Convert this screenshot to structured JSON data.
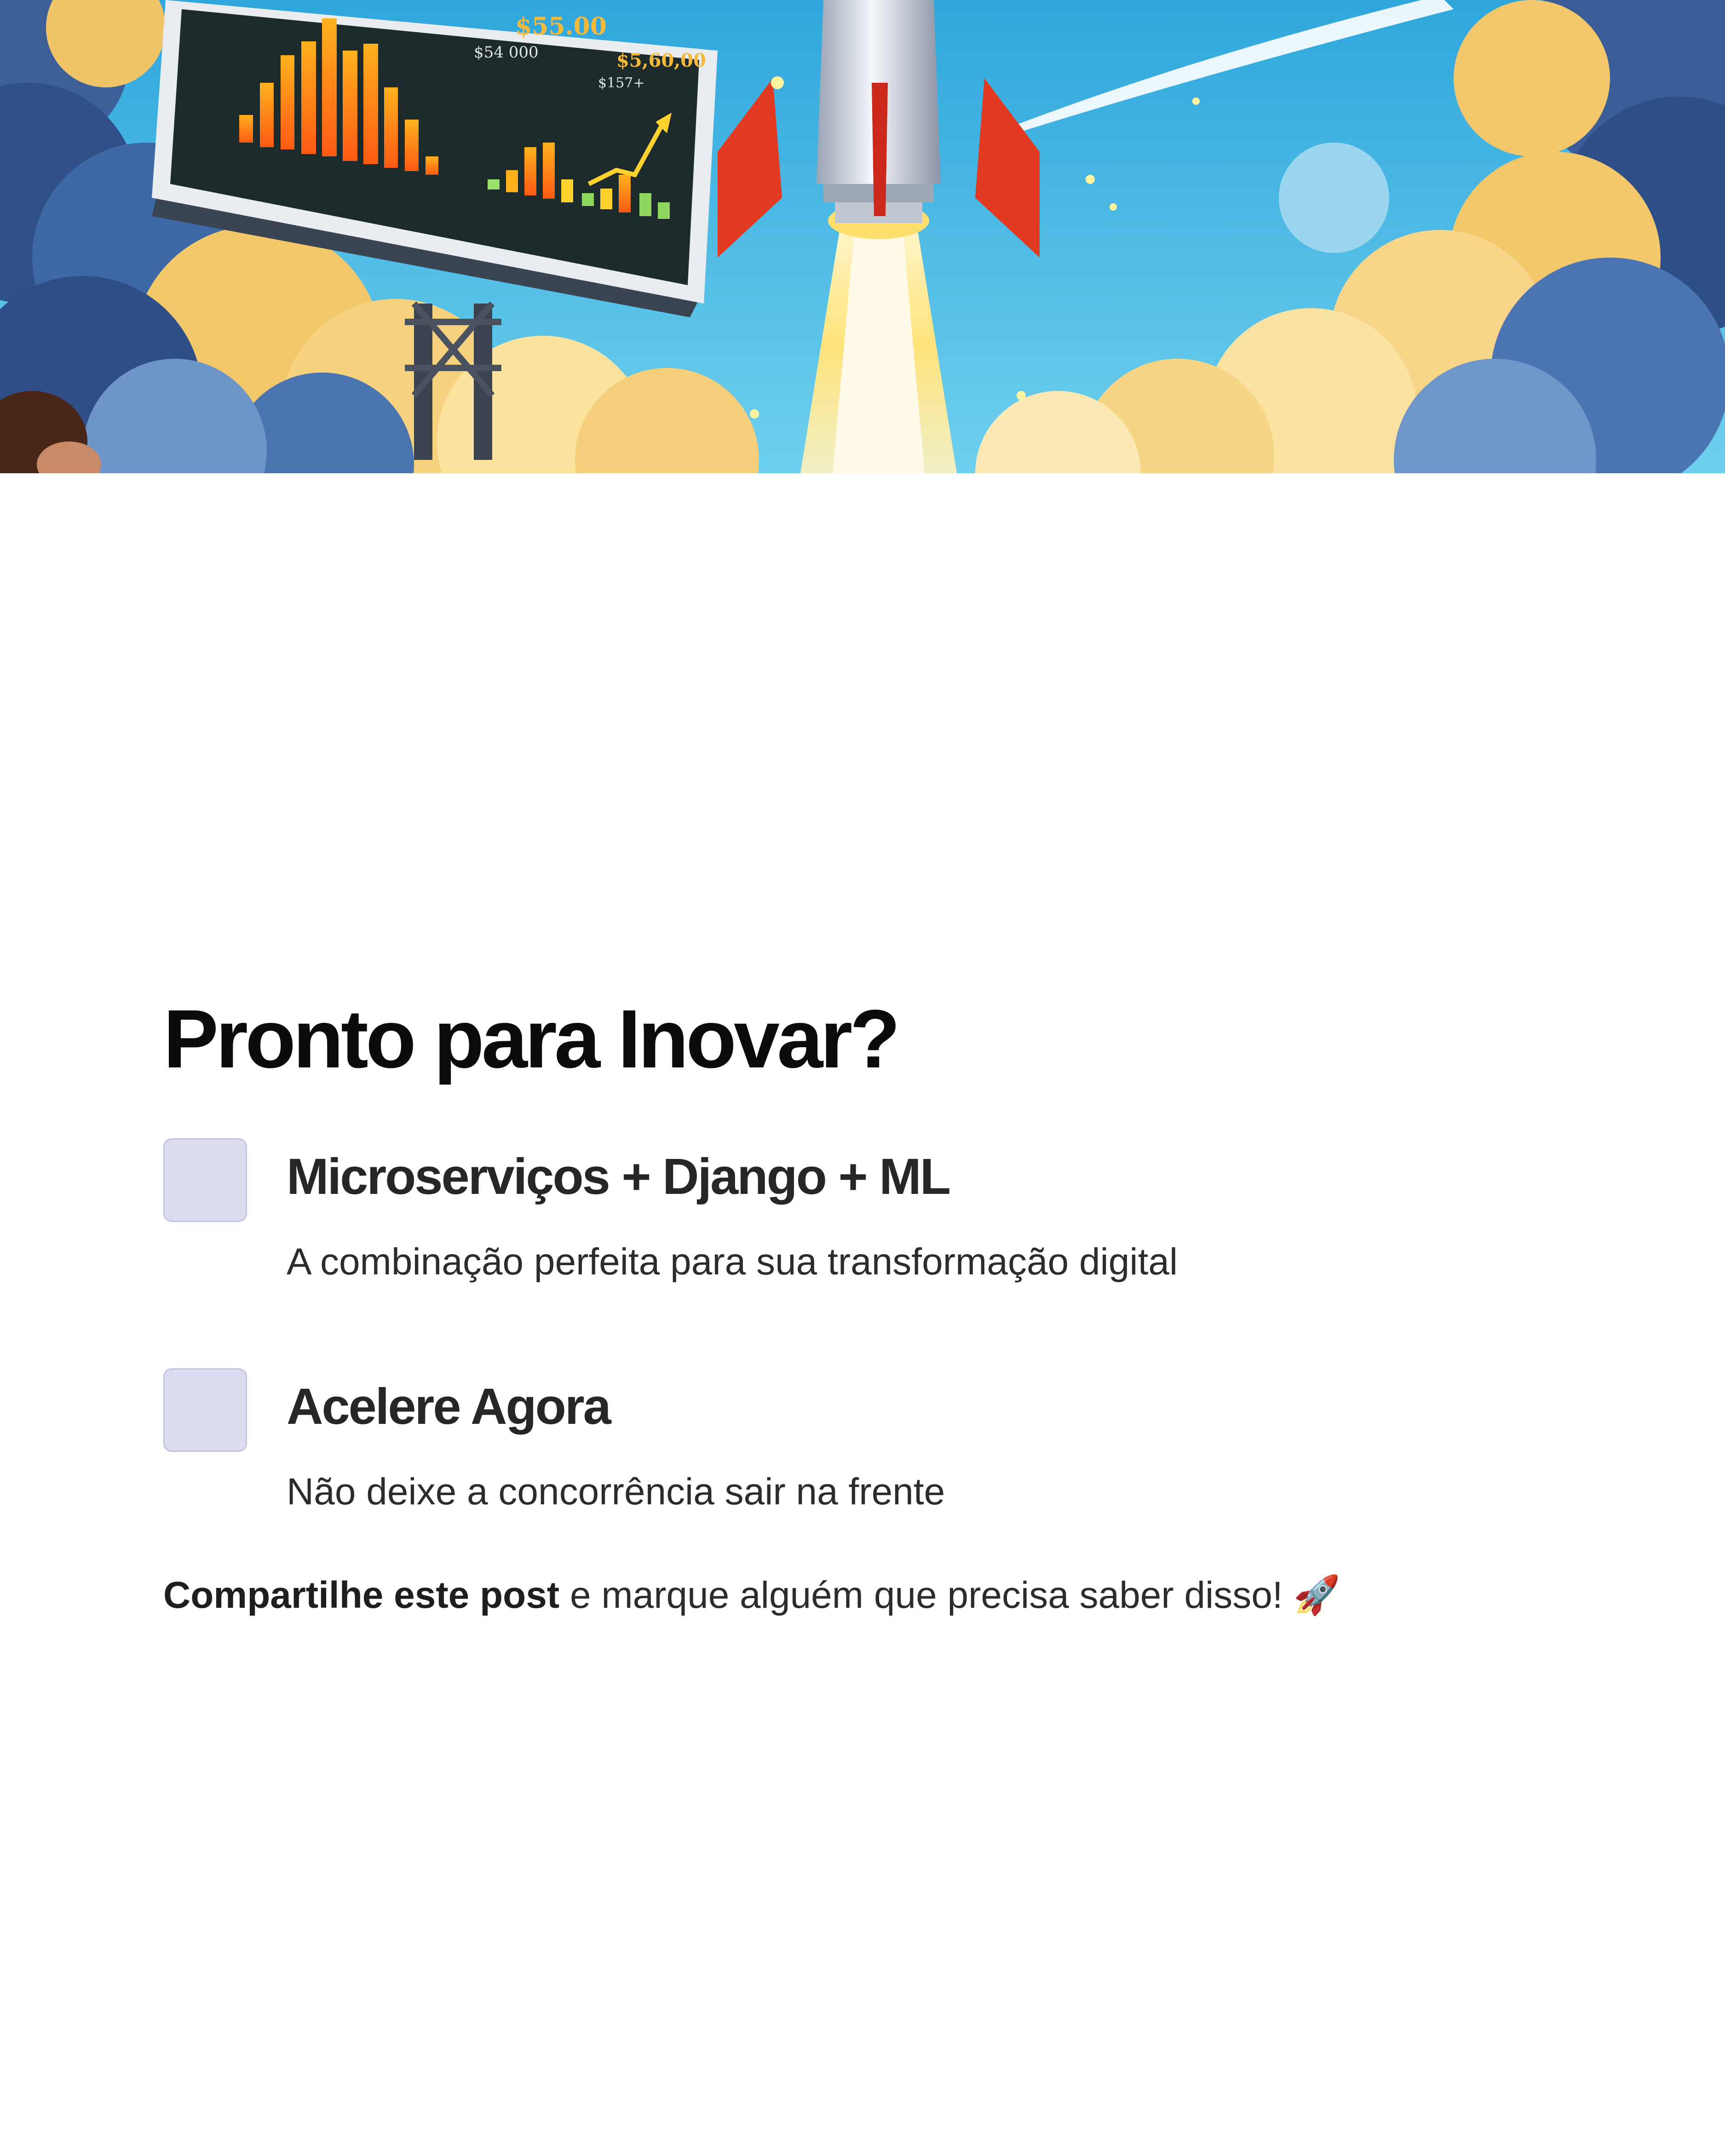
{
  "hero": {
    "board_price_1": "$55.00",
    "board_price_2": "$54 000",
    "board_price_3": "$5,60,00",
    "board_price_4": "$157+"
  },
  "content": {
    "heading": "Pronto para Inovar?",
    "items": [
      {
        "title": "Microserviços + Django + ML",
        "description": "A combinação perfeita para sua transformação digital"
      },
      {
        "title": "Acelere Agora",
        "description": "Não deixe a concorrência sair na frente"
      }
    ],
    "share": {
      "bold": "Compartilhe este post",
      "rest": " e marque alguém que precisa saber disso! 🚀"
    }
  },
  "colors": {
    "sky": "#43b6e3",
    "item_icon": "#dcdcf0",
    "heading": "#0b0b0b"
  }
}
